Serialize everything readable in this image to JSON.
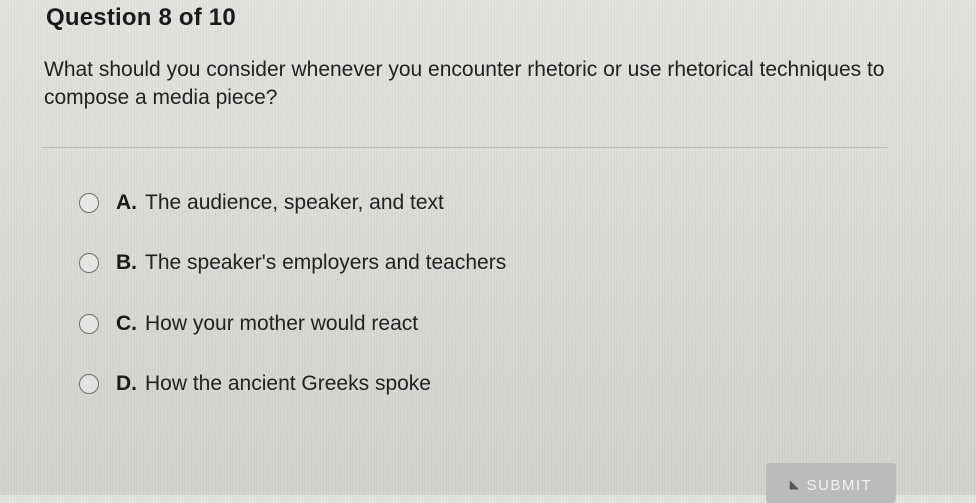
{
  "question": {
    "number_label": "Question 8 of 10",
    "text": "What should you consider whenever you encounter rhetoric or use rhetorical techniques to compose a media piece?"
  },
  "options": [
    {
      "letter": "A.",
      "text": "The audience, speaker, and text"
    },
    {
      "letter": "B.",
      "text": "The speaker's employers and teachers"
    },
    {
      "letter": "C.",
      "text": "How your mother would react"
    },
    {
      "letter": "D.",
      "text": "How the ancient Greeks spoke"
    }
  ],
  "submit": {
    "label": "SUBMIT",
    "icon": "cursor-arrow-icon"
  }
}
